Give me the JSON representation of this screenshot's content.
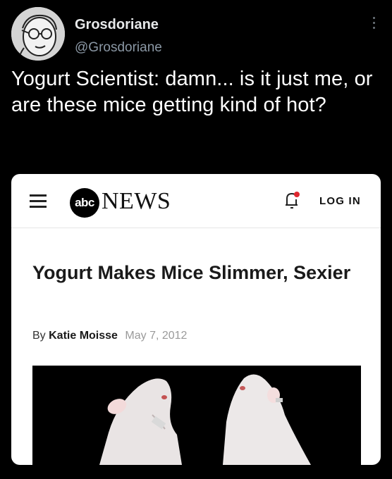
{
  "tweet": {
    "display_name": "Grosdoriane",
    "handle": "@Grosdoriane",
    "text": "Yogurt Scientist: damn... is it just me, or are these mice getting kind of hot?"
  },
  "card": {
    "logo_abc": "abc",
    "logo_news": "NEWS",
    "login_label": "LOG IN",
    "headline": "Yogurt Makes Mice Slimmer, Sexier",
    "byline_prefix": "By",
    "author": "Katie Moisse",
    "date": "May 7, 2012"
  },
  "icons": {
    "more": "vertical-ellipsis-icon",
    "menu": "hamburger-menu-icon",
    "notifications": "bell-icon",
    "alert_color": "#e0282f"
  }
}
